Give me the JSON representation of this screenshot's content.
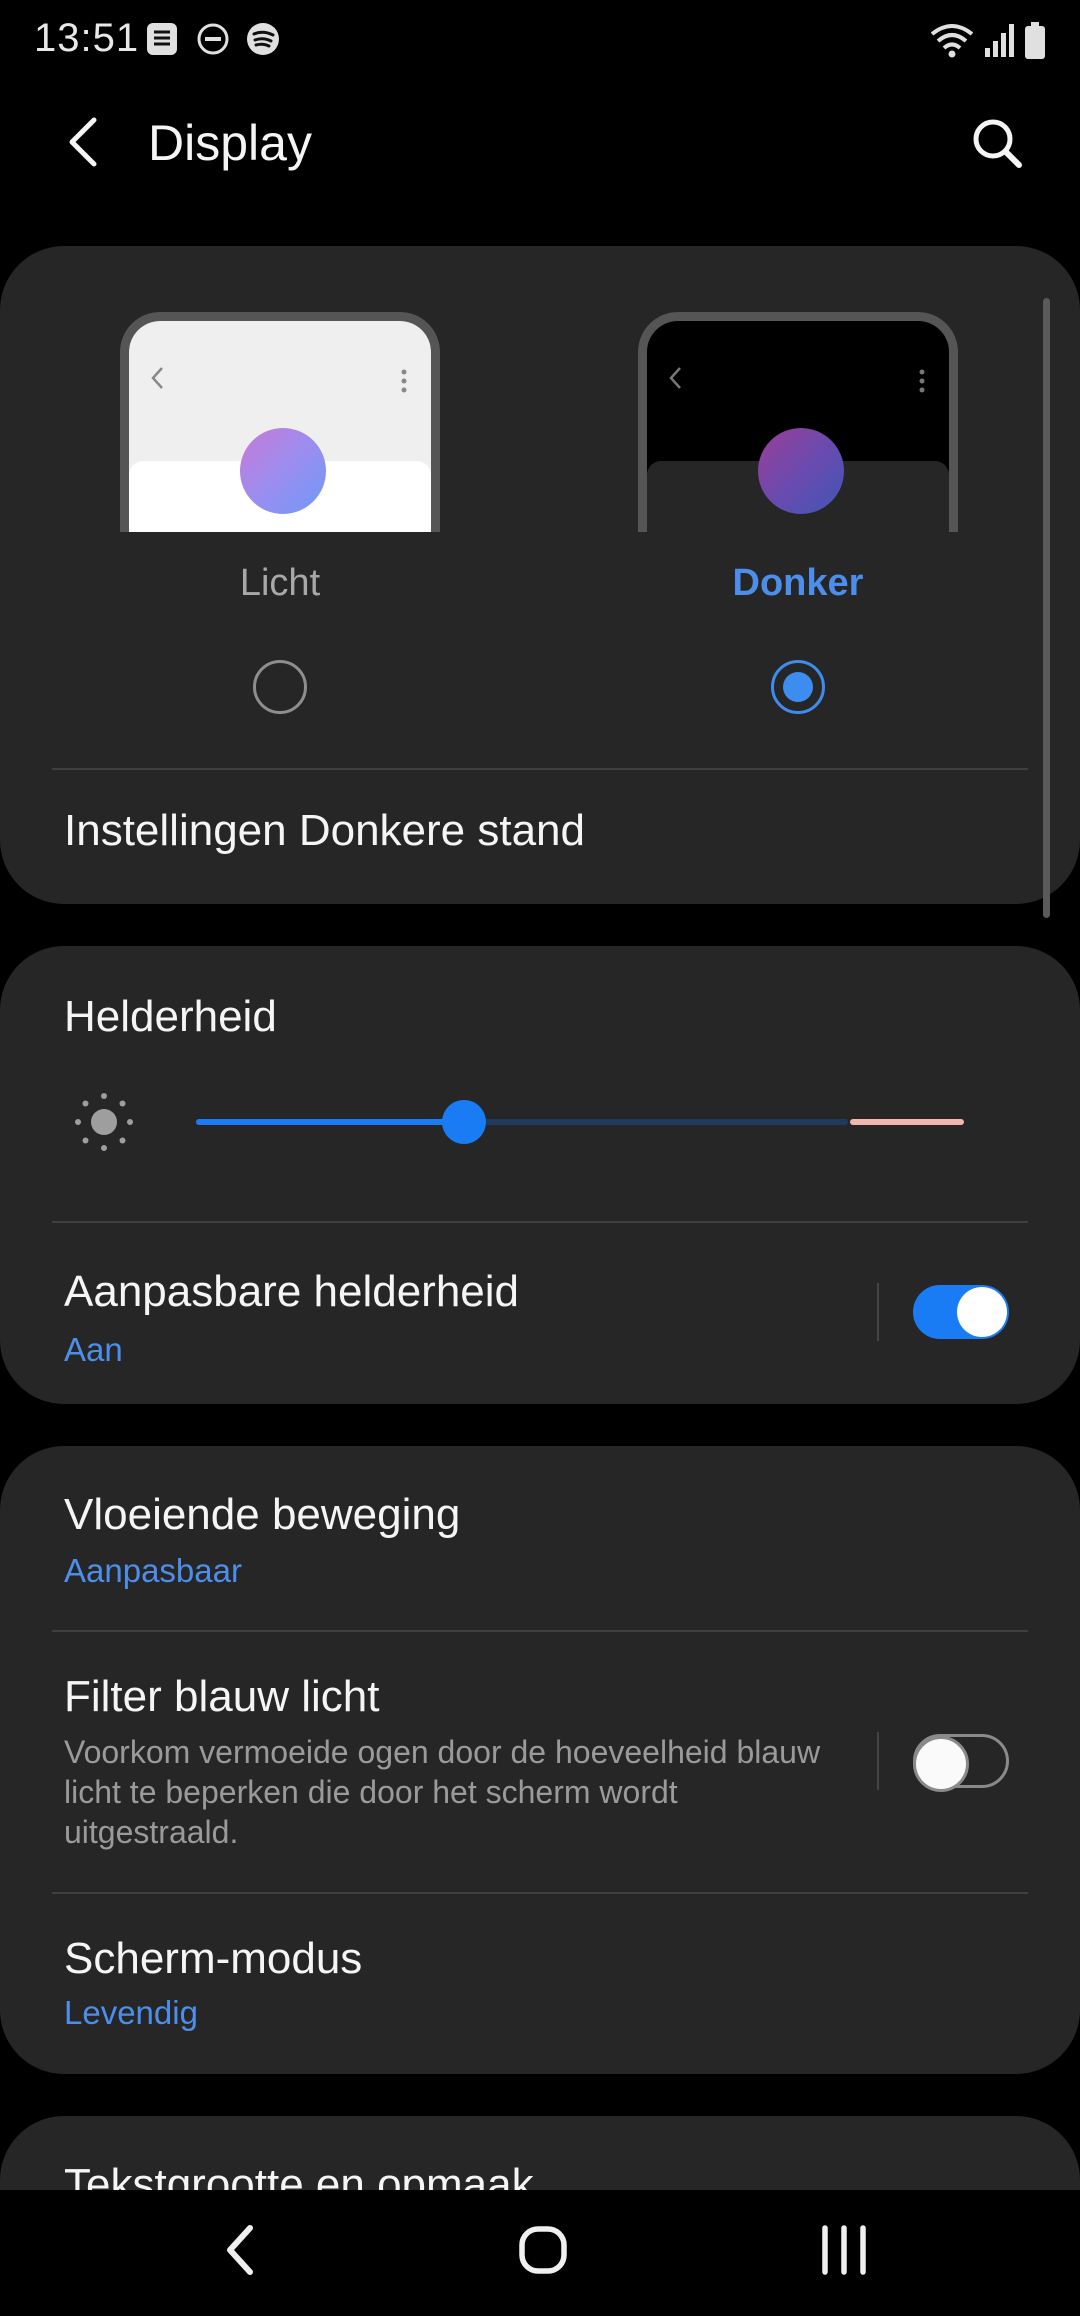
{
  "status_bar": {
    "time": "13:51",
    "left_icons": [
      "notification-stack-icon",
      "do-not-disturb-icon",
      "spotify-icon"
    ],
    "right_icons": [
      "wifi-icon",
      "signal-icon",
      "battery-icon"
    ]
  },
  "app_bar": {
    "title": "Display",
    "back_icon": "back-arrow-icon",
    "search_icon": "search-icon"
  },
  "theme": {
    "options": [
      {
        "label": "Licht",
        "selected": false
      },
      {
        "label": "Donker",
        "selected": true
      }
    ],
    "settings_label": "Instellingen Donkere stand"
  },
  "brightness": {
    "title": "Helderheid",
    "level": 0.36,
    "icon": "sun-icon"
  },
  "adaptive_brightness": {
    "title": "Aanpasbare helderheid",
    "value": "Aan",
    "enabled": true
  },
  "motion": {
    "title": "Vloeiende beweging",
    "value": "Aanpasbaar"
  },
  "blue_light": {
    "title": "Filter blauw licht",
    "description": "Voorkom vermoeide ogen door de hoeveelheid blauw licht te beperken die door het scherm wordt uitgestraald.",
    "enabled": false
  },
  "screen_mode": {
    "title": "Scherm-modus",
    "value": "Levendig"
  },
  "next_item": {
    "title": "Tekstgrootte en opmaak"
  },
  "nav_bar": {
    "icons": [
      "nav-back-icon",
      "nav-home-icon",
      "nav-recents-icon"
    ]
  },
  "colors": {
    "background": "#000000",
    "card": "#262626",
    "accent": "#1a7cf5",
    "accent_text": "#4c8eea",
    "secondary_text": "#9a9a9a"
  }
}
